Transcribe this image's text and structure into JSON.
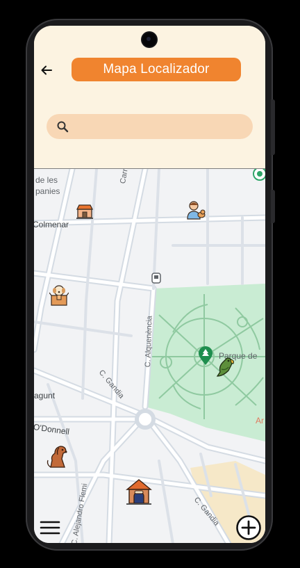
{
  "header": {
    "title": "Mapa Localizador",
    "back_icon": "arrow-back-icon"
  },
  "search": {
    "placeholder": "",
    "value": "",
    "icon": "search-icon"
  },
  "map": {
    "labels": {
      "les": "de les",
      "panies": "panies",
      "colmenar": "Colmenar",
      "carrer": "Carrer C",
      "alquenencia": "C. Alquenència",
      "gandia1": "C. Gandia",
      "parque": "Parque de",
      "agunt": "agunt",
      "odonnell": "O'Donnell",
      "flemi": "C. Alejandro Flemi",
      "gandia2": "C. Gandia",
      "ar": "Ar"
    },
    "markers": [
      "shop-marker",
      "vet-marker",
      "dog-box-marker",
      "park-pin",
      "parrot-marker",
      "dog-marker",
      "doghouse-marker"
    ],
    "colors": {
      "park": "#c9ecd3",
      "accent": "#f0842f",
      "road": "#d6dce4"
    }
  },
  "bottom": {
    "menu_icon": "hamburger-menu-icon",
    "add_icon": "add-circle-icon"
  }
}
